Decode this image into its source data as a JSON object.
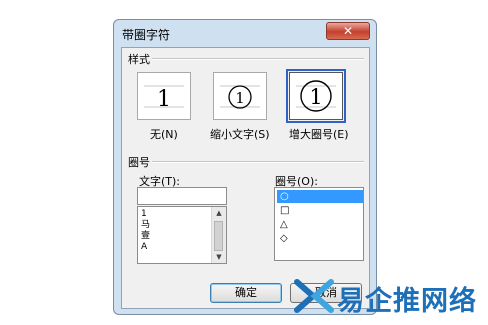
{
  "window": {
    "title": "带圈字符",
    "close_glyph": "✕"
  },
  "style_section": {
    "label": "样式",
    "options": [
      {
        "glyph": "1",
        "caption": "无(N)",
        "selected": false
      },
      {
        "glyph": "1",
        "caption": "缩小文字(S)",
        "selected": false
      },
      {
        "glyph": "1",
        "caption": "增大圈号(E)",
        "selected": true
      }
    ]
  },
  "enclosure_section": {
    "label": "圈号",
    "text_field": {
      "label": "文字(T):",
      "value": ""
    },
    "text_list": [
      "1",
      "马",
      "壹",
      "A"
    ],
    "symbol_field": {
      "label": "圈号(O):"
    },
    "symbols": [
      "○",
      "□",
      "△",
      "◇"
    ],
    "selected_symbol_index": 0
  },
  "buttons": {
    "ok": "确定",
    "cancel": "取消"
  },
  "watermark": {
    "text": "易企推网络"
  },
  "colors": {
    "dialog_frame": "#cfe0f1",
    "selection": "#3399ff",
    "watermark": "#1d6fb8"
  }
}
